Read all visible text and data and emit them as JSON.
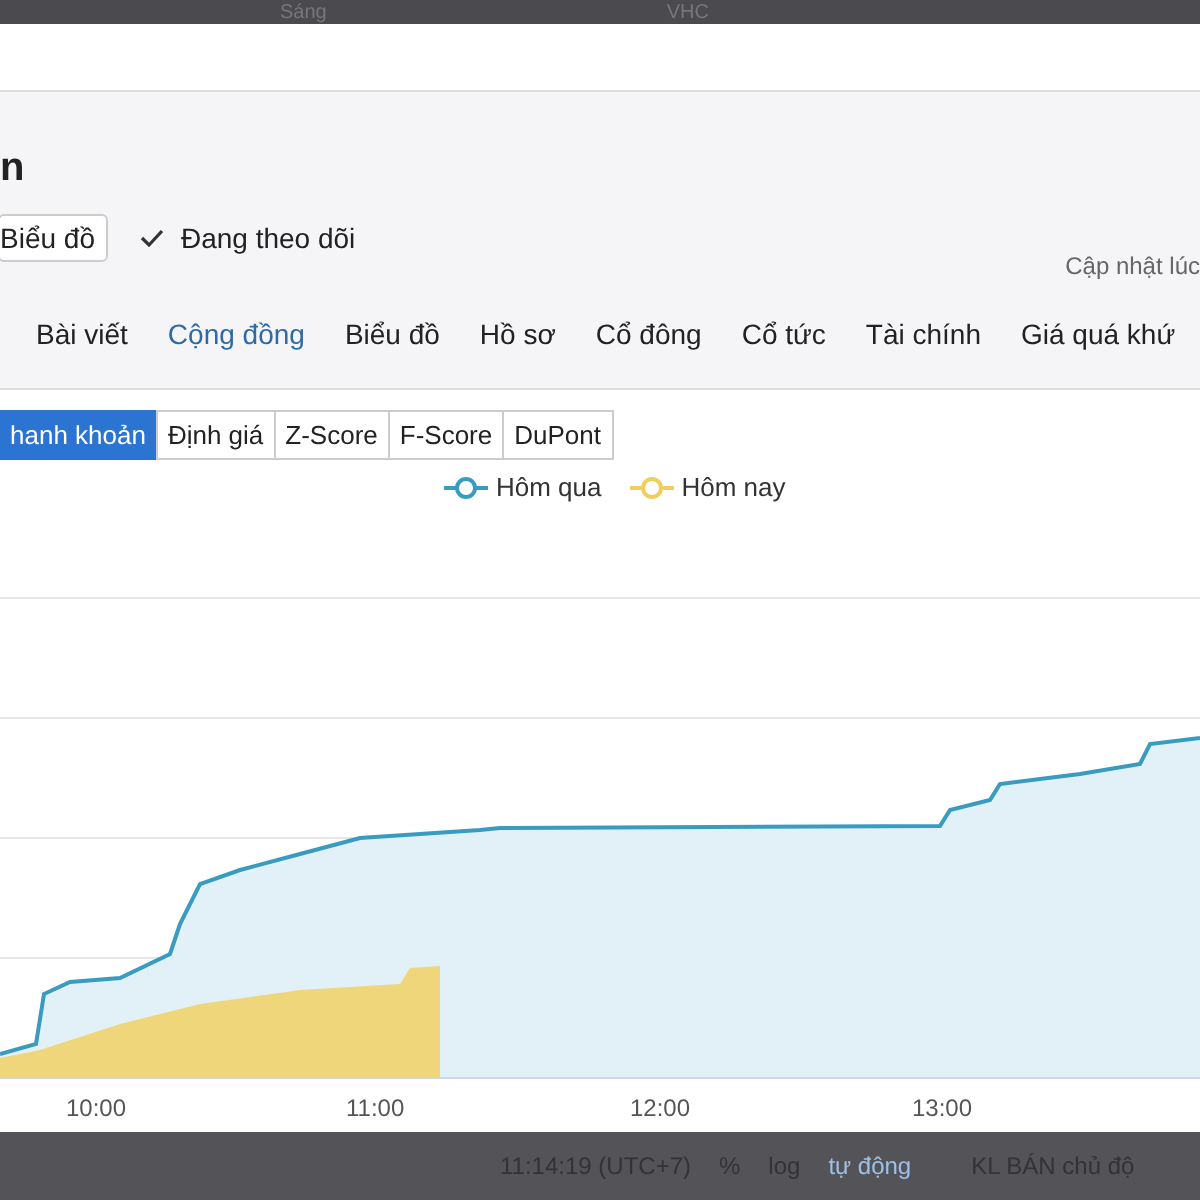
{
  "top_bar": {
    "items": [
      "Sáng",
      "VHC"
    ]
  },
  "page": {
    "title": "n",
    "chart_button": "Biểu đồ",
    "follow": {
      "label": "Đang theo dõi",
      "checked": true
    },
    "updated": "Cập nhật lúc"
  },
  "tabs": [
    {
      "label": "Bài viết",
      "selected": false
    },
    {
      "label": "Cộng đồng",
      "selected": true
    },
    {
      "label": "Biểu đồ",
      "selected": false
    },
    {
      "label": "Hồ sơ",
      "selected": false
    },
    {
      "label": "Cổ đông",
      "selected": false
    },
    {
      "label": "Cổ tức",
      "selected": false
    },
    {
      "label": "Tài chính",
      "selected": false
    },
    {
      "label": "Giá quá khứ",
      "selected": false
    }
  ],
  "sub_tabs": [
    {
      "label": "hanh khoản",
      "selected": true
    },
    {
      "label": "Định giá",
      "selected": false
    },
    {
      "label": "Z-Score",
      "selected": false
    },
    {
      "label": "F-Score",
      "selected": false
    },
    {
      "label": "DuPont",
      "selected": false
    }
  ],
  "chart": {
    "legend": [
      {
        "name": "Hôm qua",
        "color": "#3a9bc1"
      },
      {
        "name": "Hôm nay",
        "color": "#f2cf5b"
      }
    ],
    "x_labels": [
      "10:00",
      "11:00",
      "12:00",
      "13:00"
    ]
  },
  "status_bar": {
    "time": "11:14:19 (UTC+7)",
    "items": [
      "%",
      "log",
      "tự động"
    ],
    "panel": "KL BÁN chủ độ"
  }
}
